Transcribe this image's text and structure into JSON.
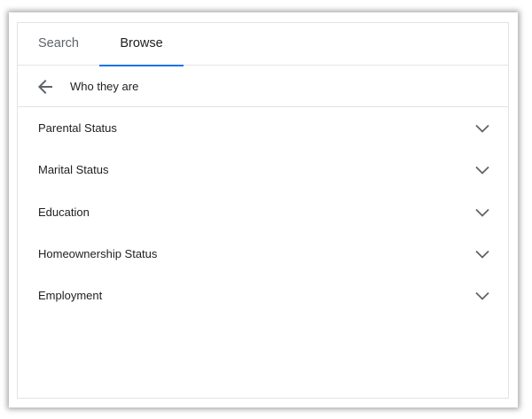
{
  "tabs": [
    {
      "label": "Search",
      "active": false
    },
    {
      "label": "Browse",
      "active": true
    }
  ],
  "accent_color": "#1a73e8",
  "subheader": {
    "back_icon": "arrow-back-icon",
    "title": "Who they are"
  },
  "categories": [
    {
      "label": "Parental Status",
      "icon": "chevron-down-icon"
    },
    {
      "label": "Marital Status",
      "icon": "chevron-down-icon"
    },
    {
      "label": "Education",
      "icon": "chevron-down-icon"
    },
    {
      "label": "Homeownership Status",
      "icon": "chevron-down-icon"
    },
    {
      "label": "Employment",
      "icon": "chevron-down-icon"
    }
  ]
}
